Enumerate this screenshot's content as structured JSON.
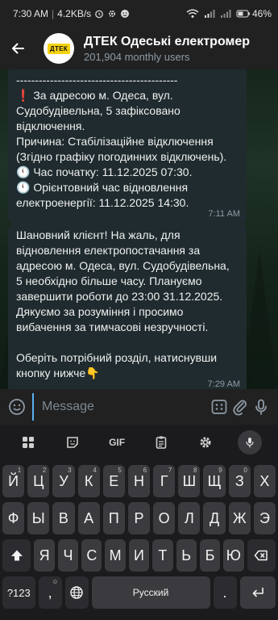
{
  "status_bar": {
    "time": "7:30 AM",
    "speed": "4.2KB/s",
    "battery": "46"
  },
  "header": {
    "title": "ДТЕК Одеські електромер",
    "subtitle": "201,904 monthly users",
    "avatar_text": "ДТЕК"
  },
  "messages": [
    {
      "lines": [
        "-------------------------------------------",
        "❗ За адресою м. Одеса, вул. Судобудівельна, 5 зафіксовано відключення.",
        "Причина: Стабілізаційне відключення (Згідно графіку погодинних відключень).",
        "🕚 Час початку: 11.12.2025 07:30.",
        "🕚 Орієнтовний час відновлення електроенергії: 11.12.2025 14:30."
      ],
      "time": "7:11 AM"
    },
    {
      "lines": [
        "Шановний клієнт! На жаль, для відновлення електропостачання за адресою м. Одеса, вул. Судобудівельна, 5 необхідно більше часу. Плануємо завершити роботи до 23:00 31.12.2025. Дякуємо за розуміння і просимо вибачення за тимчасові незручності.",
        "",
        "Оберіть потрібний розділ, натиснувши кнопку нижче👇"
      ],
      "time": "7:29 AM"
    }
  ],
  "input": {
    "placeholder": "Message"
  },
  "keyboard": {
    "toolbar": {
      "gif_label": "GIF"
    },
    "row1": [
      {
        "k": "Й",
        "h": "1"
      },
      {
        "k": "Ц",
        "h": "2"
      },
      {
        "k": "У",
        "h": "3"
      },
      {
        "k": "К",
        "h": "4"
      },
      {
        "k": "Е",
        "h": "5"
      },
      {
        "k": "Н",
        "h": "6"
      },
      {
        "k": "Г",
        "h": "7"
      },
      {
        "k": "Ш",
        "h": "8"
      },
      {
        "k": "Щ",
        "h": "9"
      },
      {
        "k": "З",
        "h": "0"
      },
      {
        "k": "Х",
        "h": ""
      }
    ],
    "row2": [
      "Ф",
      "Ы",
      "В",
      "А",
      "П",
      "Р",
      "О",
      "Л",
      "Д",
      "Ж",
      "Э"
    ],
    "row3": [
      "Я",
      "Ч",
      "С",
      "М",
      "И",
      "Т",
      "Ь",
      "Б",
      "Ю"
    ],
    "bottom": {
      "symbols_label": "?123",
      "comma_label": ",",
      "space_label": "Русский",
      "period_label": "."
    }
  }
}
